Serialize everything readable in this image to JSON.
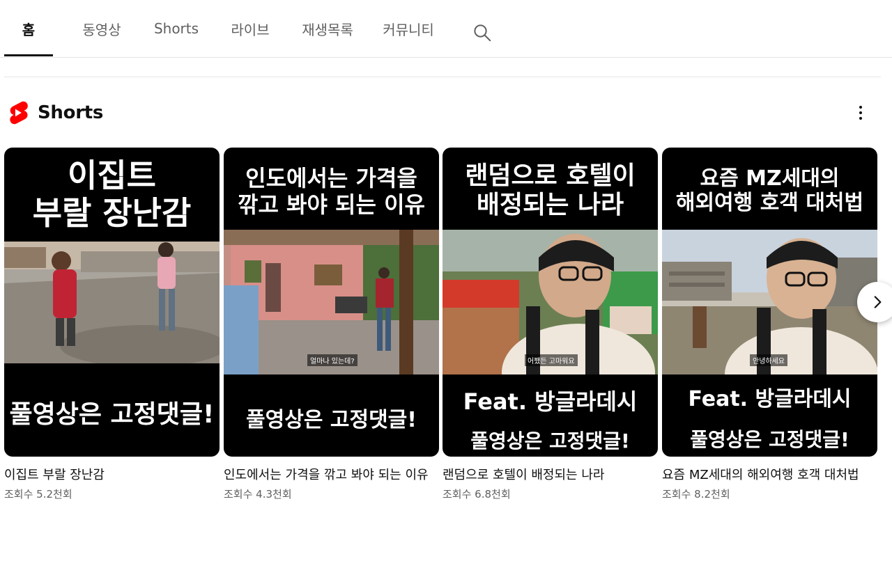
{
  "tabs": [
    {
      "label": "홈",
      "active": true
    },
    {
      "label": "동영상"
    },
    {
      "label": "Shorts"
    },
    {
      "label": "라이브"
    },
    {
      "label": "재생목록"
    },
    {
      "label": "커뮤니티"
    }
  ],
  "search_icon": "search-icon",
  "section": {
    "title": "Shorts",
    "logo": "shorts-logo-icon",
    "more_icon": "more-vert-icon"
  },
  "accent_color": "#ff0000",
  "cards": [
    {
      "overlay_top": [
        "이집트",
        "부랄 장난감"
      ],
      "overlay_bottom": [
        "풀영상은 고정댓글!"
      ],
      "subtitle": "",
      "title": "이집트 부랄 장난감",
      "views": "조회수 5.2천회"
    },
    {
      "overlay_top": [
        "인도에서는 가격을",
        "깎고 봐야 되는 이유"
      ],
      "overlay_bottom": [
        "풀영상은 고정댓글!"
      ],
      "subtitle": "얼마나 있는데?",
      "title": "인도에서는 가격을 깎고 봐야 되는 이유",
      "views": "조회수 4.3천회"
    },
    {
      "overlay_top": [
        "랜덤으로 호텔이",
        "배정되는 나라"
      ],
      "overlay_bottom": [
        "Feat. 방글라데시",
        "풀영상은 고정댓글!"
      ],
      "subtitle": "어쨌든 고마워요",
      "title": "랜덤으로 호텔이 배정되는 나라",
      "views": "조회수 6.8천회"
    },
    {
      "overlay_top": [
        "요즘 MZ세대의",
        "해외여행 호객 대처법"
      ],
      "overlay_bottom": [
        "Feat. 방글라데시",
        "풀영상은 고정댓글!"
      ],
      "subtitle": "안녕하세요",
      "title": "요즘 MZ세대의 해외여행 호객 대처법",
      "views": "조회수 8.2천회"
    }
  ],
  "next_icon": "chevron-right-icon"
}
